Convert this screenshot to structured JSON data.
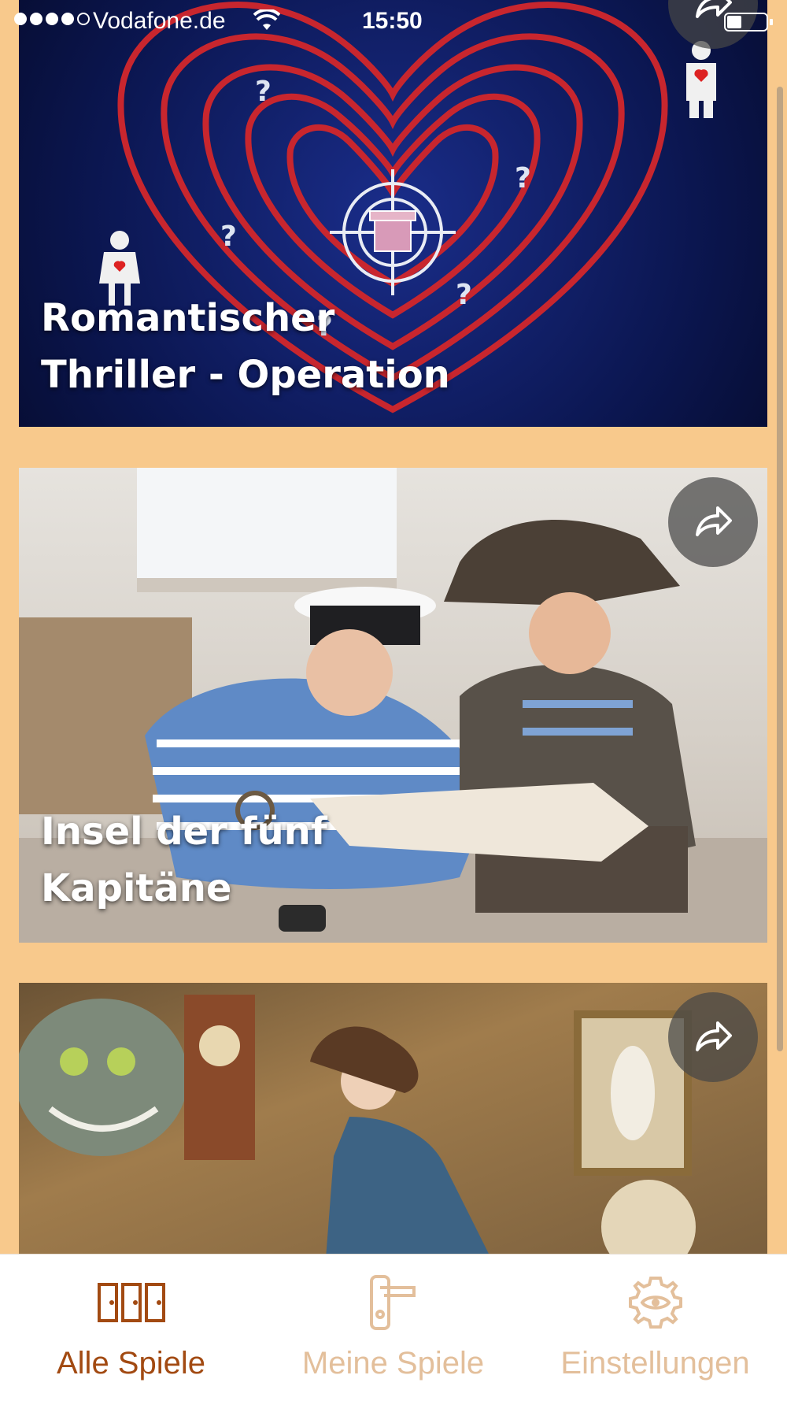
{
  "status_bar": {
    "carrier": "Vodafone.de",
    "time": "15:50",
    "signal_bars_filled": 4,
    "battery_level": 0.3
  },
  "games": [
    {
      "title_line1": "Romantischer",
      "title_line2": "Thriller - Operation",
      "share_icon": "share-arrow-icon"
    },
    {
      "title_line1": "Insel der fünf",
      "title_line2": "Kapitäne",
      "share_icon": "share-arrow-icon"
    },
    {
      "title_line1": "",
      "title_line2": "",
      "share_icon": "share-arrow-icon"
    }
  ],
  "tab_bar": {
    "tabs": [
      {
        "label": "Alle Spiele",
        "icon": "doors-icon",
        "active": true
      },
      {
        "label": "Meine Spiele",
        "icon": "door-handle-icon",
        "active": false
      },
      {
        "label": "Einstellungen",
        "icon": "gear-eye-icon",
        "active": false
      }
    ]
  },
  "colors": {
    "background": "#f8c98c",
    "tab_active": "#a24a12",
    "tab_inactive": "#e3bf9b"
  }
}
